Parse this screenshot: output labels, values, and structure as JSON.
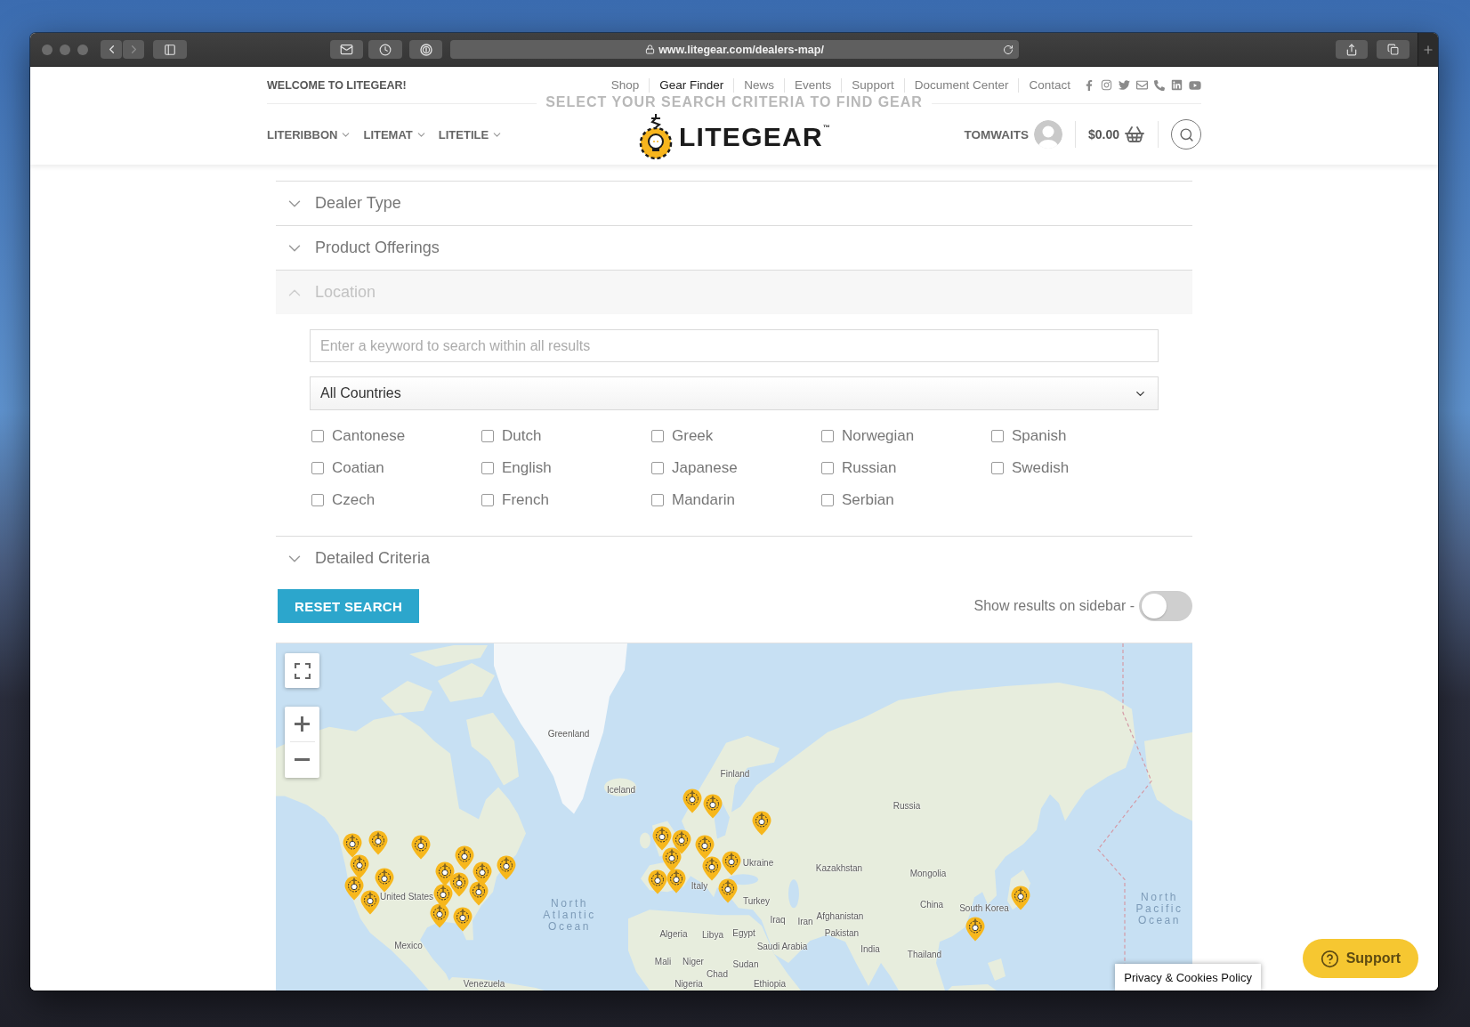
{
  "browser": {
    "url": "www.litegear.com/dealers-map/"
  },
  "top_bar": {
    "welcome": "WELCOME TO LITEGEAR!",
    "links": [
      {
        "label": "Shop",
        "selected": false
      },
      {
        "label": "Gear Finder",
        "selected": true
      },
      {
        "label": "News",
        "selected": false
      },
      {
        "label": "Events",
        "selected": false
      },
      {
        "label": "Support",
        "selected": false
      },
      {
        "label": "Document Center",
        "selected": false
      },
      {
        "label": "Contact",
        "selected": false
      }
    ]
  },
  "page_heading": "SELECT YOUR SEARCH CRITERIA TO FIND GEAR",
  "header": {
    "menu": [
      "LITERIBBON",
      "LITEMAT",
      "LITETILE"
    ],
    "logo": "LITEGEAR$^{™}$",
    "account": "TOMWAITS",
    "cart_total": "$0.00"
  },
  "filters": {
    "sections": [
      {
        "title": "Dealer Type",
        "expanded": false
      },
      {
        "title": "Product Offerings",
        "expanded": false
      },
      {
        "title": "Location",
        "expanded": true,
        "search": {
          "placeholder": "Enter a keyword to search within all results"
        },
        "country_select": {
          "value": "All Countries"
        },
        "languages": [
          {
            "label": "Cantonese",
            "checked": false
          },
          {
            "label": "Coatian",
            "checked": false
          },
          {
            "label": "Czech",
            "checked": false
          },
          {
            "label": "Dutch",
            "checked": false
          },
          {
            "label": "English",
            "checked": false
          },
          {
            "label": "French",
            "checked": false
          },
          {
            "label": "Greek",
            "checked": false
          },
          {
            "label": "Japanese",
            "checked": false
          },
          {
            "label": "Mandarin",
            "checked": false
          },
          {
            "label": "Norwegian",
            "checked": false
          },
          {
            "label": "Russian",
            "checked": false
          },
          {
            "label": "Serbian",
            "checked": false
          },
          {
            "label": "Spanish",
            "checked": false
          },
          {
            "label": "Swedish",
            "checked": false
          }
        ]
      },
      {
        "title": "Detailed Criteria",
        "expanded": false
      }
    ]
  },
  "actions": {
    "reset_button": "RESET SEARCH",
    "sidebar_toggle": {
      "label": "Show results on sidebar -",
      "on": false
    }
  },
  "map": {
    "places": [
      "Greenland",
      "Finland",
      "Iceland",
      "Russia",
      "Ukraine",
      "Kazakhstan",
      "Mongolia",
      "Italy",
      "United States",
      "Turkey",
      "China",
      "South Korea",
      "Iraq",
      "Iran",
      "Afghanistan",
      "Algeria",
      "Libya",
      "Egypt",
      "Pakistan",
      "Mexico",
      "Saudi Arabia",
      "India",
      "Thailand",
      "Mali",
      "Niger",
      "Sudan",
      "Chad",
      "Venezuela",
      "Nigeria",
      "Ethiopia"
    ],
    "oceans": [
      "North Atlantic Ocean",
      "North Pacific Ocean"
    ]
  },
  "cookie_notice": "Privacy & Cookies Policy",
  "support_button": "Support"
}
